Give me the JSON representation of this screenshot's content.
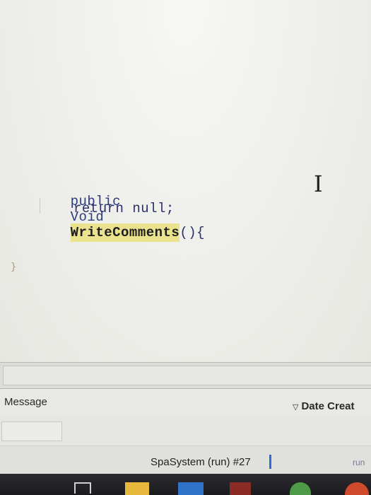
{
  "editor": {
    "line1": {
      "keyword_public": "public",
      "keyword_void": "Void",
      "method_name": "WriteComments",
      "suffix": "(){"
    },
    "line2": "return null;",
    "closing_brace": "}"
  },
  "output_panel": {
    "columns": {
      "message": "Message",
      "date_created": "Date Creat"
    }
  },
  "status_bar": {
    "task_label": "SpaSystem (run) #27",
    "run_label": "run"
  },
  "taskbar": {
    "icons": [
      "task-view-icon",
      "file-explorer-icon",
      "mail-icon",
      "app-icon",
      "chrome-icon",
      "browser-icon"
    ]
  },
  "colors": {
    "highlight": "#ebe28d",
    "code_text": "#2b2f6a",
    "caret": "#2f6bd6"
  }
}
